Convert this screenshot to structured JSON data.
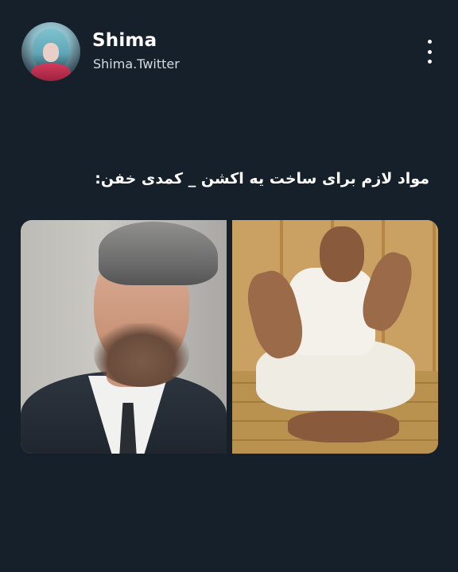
{
  "post": {
    "author_name": "Shima",
    "author_handle": "Shima.Twitter",
    "text": "مواد لازم برای ساخت یه اکشن _ کمدی خفن:",
    "images": [
      {
        "icon": "man-in-suit-photo"
      },
      {
        "icon": "man-sitting-on-floor-photo"
      }
    ],
    "menu_icon": "more-vertical-icon"
  },
  "colors": {
    "background": "#16202b",
    "text": "#ffffff",
    "handle_text": "#d6dbe0"
  }
}
